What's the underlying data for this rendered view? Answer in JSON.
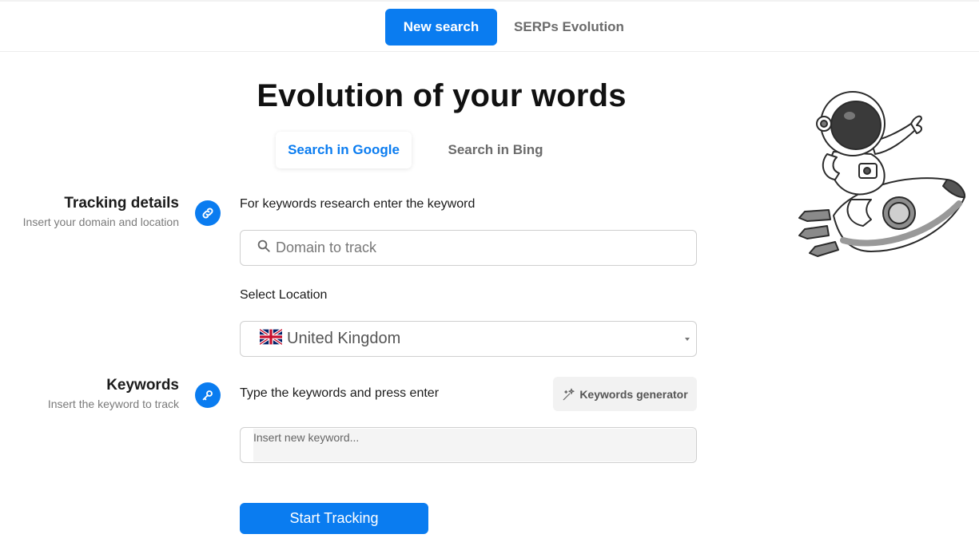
{
  "header": {
    "tabs": [
      {
        "label": "New search",
        "active": true
      },
      {
        "label": "SERPs Evolution",
        "active": false
      }
    ]
  },
  "main": {
    "title": "Evolution of your words",
    "engine_tabs": [
      {
        "label": "Search in Google",
        "active": true
      },
      {
        "label": "Search in Bing",
        "active": false
      }
    ]
  },
  "tracking": {
    "heading": "Tracking details",
    "subheading": "Insert your domain and location",
    "icon": "link-icon",
    "keyword_label": "For keywords research enter the keyword",
    "domain_placeholder": "Domain to track",
    "location_label": "Select Location",
    "location_value": "United Kingdom",
    "location_flag": "uk-flag-icon"
  },
  "keywords": {
    "heading": "Keywords",
    "subheading": "Insert the keyword to track",
    "icon": "key-icon",
    "type_label": "Type the keywords and press enter",
    "generator_label": "Keywords generator",
    "input_placeholder": "Insert new keyword..."
  },
  "actions": {
    "start_label": "Start Tracking"
  },
  "colors": {
    "accent": "#0a7cf0",
    "muted_text": "#6b6b6b"
  }
}
